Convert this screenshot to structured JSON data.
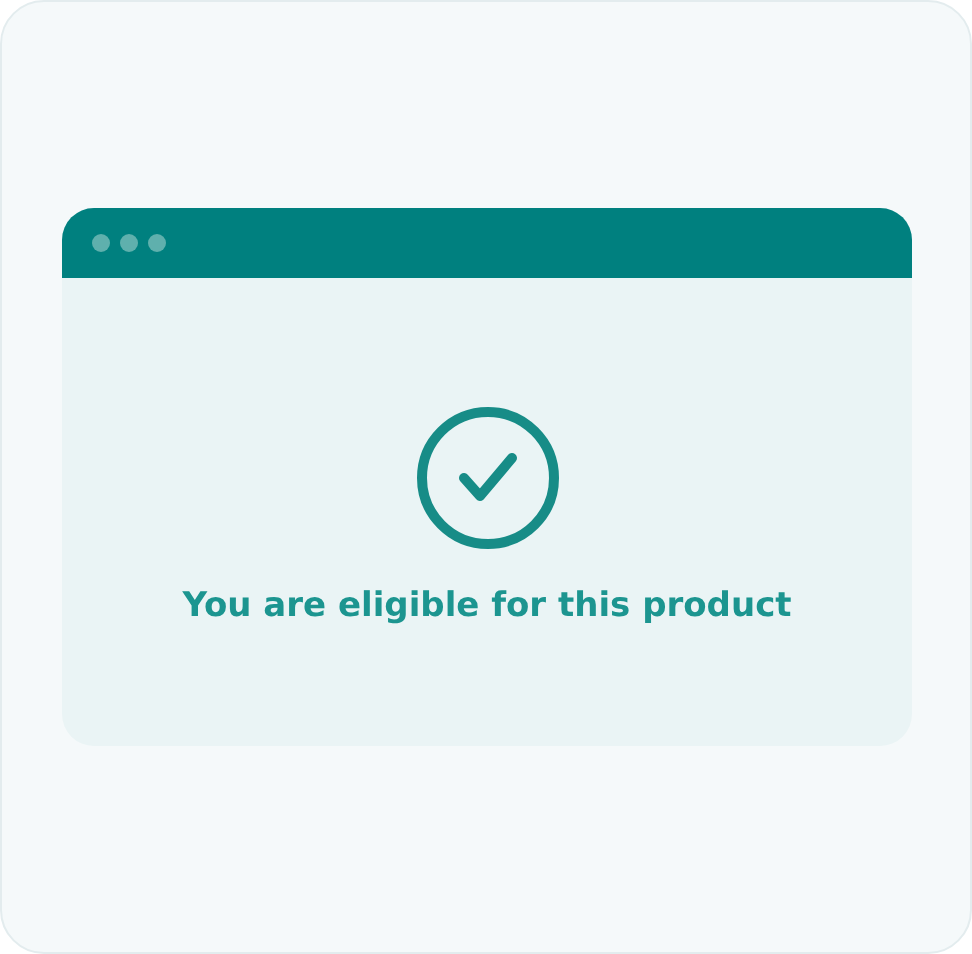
{
  "result": {
    "kind": "success",
    "message": "You are eligible for this product"
  }
}
